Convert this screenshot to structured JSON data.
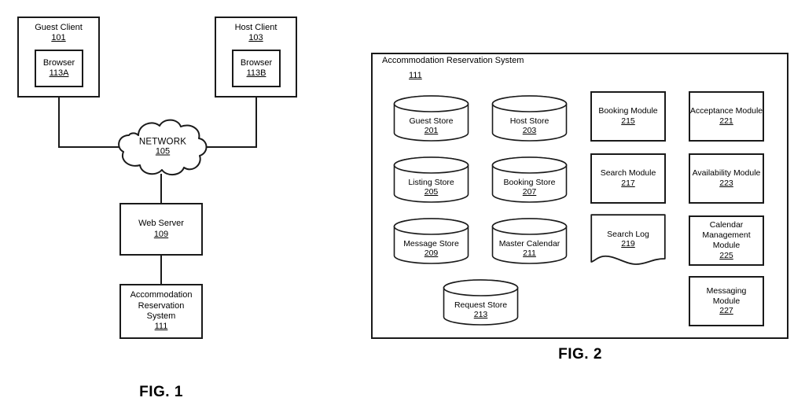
{
  "figure1": {
    "caption": "FIG. 1",
    "nodes": {
      "guest_client": {
        "label": "Guest Client",
        "ref": "101"
      },
      "guest_browser": {
        "label": "Browser",
        "ref": "113A"
      },
      "host_client": {
        "label": "Host Client",
        "ref": "103"
      },
      "host_browser": {
        "label": "Browser",
        "ref": "113B"
      },
      "network": {
        "label": "NETWORK",
        "ref": "105"
      },
      "web_server": {
        "label": "Web Server",
        "ref": "109"
      },
      "accommodation_reservation_system": {
        "line1": "Accommodation",
        "line2": "Reservation",
        "line3": "System",
        "ref": "111"
      }
    }
  },
  "figure2": {
    "caption": "FIG. 2",
    "title": "Accommodation Reservation System",
    "title_ref": "111",
    "stores": [
      {
        "label": "Guest Store",
        "ref": "201"
      },
      {
        "label": "Host Store",
        "ref": "203"
      },
      {
        "label": "Listing Store",
        "ref": "205"
      },
      {
        "label": "Booking Store",
        "ref": "207"
      },
      {
        "label": "Message Store",
        "ref": "209"
      },
      {
        "label": "Master Calendar",
        "ref": "211"
      },
      {
        "label": "Request Store",
        "ref": "213"
      }
    ],
    "modules": [
      {
        "label": "Booking Module",
        "ref": "215"
      },
      {
        "label": "Acceptance Module",
        "ref": "221"
      },
      {
        "label": "Search Module",
        "ref": "217"
      },
      {
        "label": "Availability Module",
        "ref": "223"
      },
      {
        "label": "Messaging Module",
        "ref": "227",
        "line1": "Messaging",
        "line2": "Module"
      }
    ],
    "calendar_module": {
      "line1": "Calendar",
      "line2": "Management",
      "line3": "Module",
      "ref": "225"
    },
    "search_log": {
      "label": "Search Log",
      "ref": "219"
    }
  },
  "colors": {
    "stroke": "#1a1a1a",
    "background": "#ffffff",
    "text": "#000000"
  }
}
